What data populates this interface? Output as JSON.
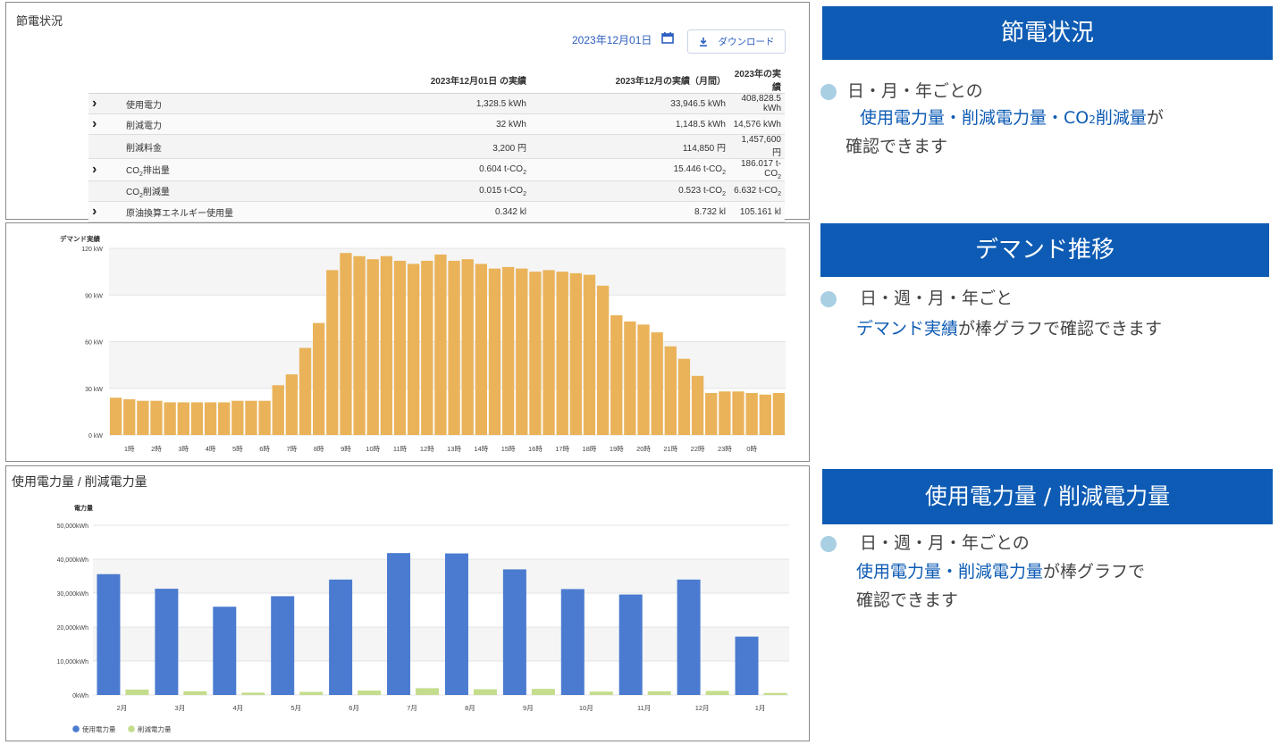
{
  "summary": {
    "title": "節電状況",
    "date": "2023年12月01日",
    "download_label": "ダウンロード",
    "columns": [
      "2023年12月01日 の実績",
      "2023年12月の実績（月間）",
      "2023年の実績"
    ],
    "rows": [
      {
        "label": "使用電力",
        "has_expand": true,
        "day": "1,328.5 kWh",
        "month": "33,946.5 kWh",
        "year": "408,828.5 kWh"
      },
      {
        "label": "削減電力",
        "has_expand": true,
        "day": "32 kWh",
        "month": "1,148.5 kWh",
        "year": "14,576 kWh"
      },
      {
        "label": "削減料金",
        "has_expand": false,
        "day": "3,200 円",
        "month": "114,850 円",
        "year": "1,457,600 円"
      },
      {
        "label": "CO2排出量",
        "has_expand": true,
        "day": "0.604 t-CO2",
        "month": "15.446 t-CO2",
        "year": "186.017 t-CO2"
      },
      {
        "label": "CO2削減量",
        "has_expand": false,
        "day": "0.015 t-CO2",
        "month": "0.523 t-CO2",
        "year": "6.632 t-CO2"
      },
      {
        "label": "原油換算エネルギー使用量",
        "has_expand": true,
        "day": "0.342 kl",
        "month": "8.732 kl",
        "year": "105.161 kl"
      }
    ]
  },
  "chart_data": [
    {
      "type": "bar",
      "title": "デマンド実績",
      "ylim": [
        0,
        120
      ],
      "yticks": [
        "0 kW",
        "30 kW",
        "60 kW",
        "90 kW",
        "120 kW"
      ],
      "xtick_labels": [
        "1時",
        "2時",
        "3時",
        "4時",
        "5時",
        "6時",
        "7時",
        "8時",
        "9時",
        "10時",
        "11時",
        "12時",
        "13時",
        "14時",
        "15時",
        "16時",
        "17時",
        "18時",
        "19時",
        "20時",
        "21時",
        "22時",
        "23時",
        "0時"
      ],
      "values": [
        24,
        23,
        22,
        22,
        21,
        21,
        21,
        21,
        21,
        22,
        22,
        22,
        32,
        39,
        56,
        72,
        106,
        117,
        115,
        113,
        115,
        112,
        110,
        112,
        116,
        112,
        113,
        110,
        107,
        108,
        107,
        105,
        106,
        105,
        104,
        103,
        96,
        77,
        73,
        71,
        66,
        57,
        49,
        38,
        27,
        28,
        28,
        27,
        26,
        27
      ],
      "color": "#eab35a",
      "grid": true
    },
    {
      "type": "bar",
      "title": "使用電力量 / 削減電力量",
      "ylabel": "電力量",
      "ylim": [
        0,
        50000
      ],
      "yticks": [
        "0kWh",
        "10,000kWh",
        "20,000kWh",
        "30,000kWh",
        "40,000kWh",
        "50,000kWh"
      ],
      "categories": [
        "2月",
        "3月",
        "4月",
        "5月",
        "6月",
        "7月",
        "8月",
        "9月",
        "10月",
        "11月",
        "12月",
        "1月"
      ],
      "series": [
        {
          "name": "使用電力量",
          "color": "#4a7bd0",
          "values": [
            35600,
            31300,
            26000,
            29100,
            34000,
            41800,
            41700,
            37000,
            31200,
            29600,
            34000,
            17200
          ]
        },
        {
          "name": "削減電力量",
          "color": "#c4dd8c",
          "values": [
            1600,
            1100,
            700,
            900,
            1300,
            2000,
            1700,
            1800,
            1000,
            1100,
            1200,
            600
          ]
        }
      ],
      "legend_position": "bottom-left",
      "grid": true
    }
  ],
  "right": {
    "h1": "節電状況",
    "d1": {
      "l1": "日・月・年ごとの",
      "l2": "使用電力量・削減電力量・CO",
      "l2_sub": "2",
      "l2_b": "削減量",
      "l2_end": "が",
      "l3": "確認できます"
    },
    "h2": "デマンド推移",
    "d2": {
      "l1": "日・週・月・年ごと",
      "l2_blue": "デマンド実績",
      "l2_end": "が棒グラフで確認できます"
    },
    "h3": "使用電力量 / 削減電力量",
    "d3": {
      "l1": "日・週・月・年ごとの",
      "l2_blue": "使用電力量・削減電力量",
      "l2_end": "が棒グラフで",
      "l3": "確認できます"
    }
  }
}
